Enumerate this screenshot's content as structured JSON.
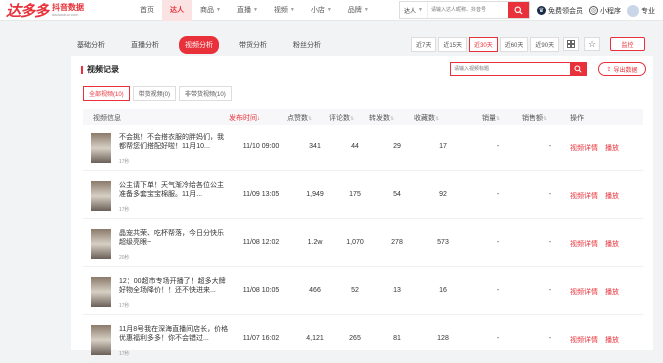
{
  "header": {
    "logo": "达多多",
    "logo_sub": "抖音数据",
    "logo_domain": "daduoduo.com",
    "nav": [
      {
        "label": "首页",
        "active": false,
        "caret": false
      },
      {
        "label": "达人",
        "active": true,
        "caret": false
      },
      {
        "label": "商品",
        "active": false,
        "caret": true
      },
      {
        "label": "直播",
        "active": false,
        "caret": true
      },
      {
        "label": "视频",
        "active": false,
        "caret": true
      },
      {
        "label": "小店",
        "active": false,
        "caret": true
      },
      {
        "label": "品牌",
        "active": false,
        "caret": true
      }
    ],
    "search_type": "达人",
    "search_placeholder": "请输入达人昵称、抖音号",
    "vip_label": "免费领会员",
    "miniapp_label": "小程序",
    "user_label": "专业"
  },
  "subnav": {
    "tabs": [
      {
        "label": "基础分析",
        "active": false
      },
      {
        "label": "直播分析",
        "active": false
      },
      {
        "label": "视频分析",
        "active": true
      },
      {
        "label": "带货分析",
        "active": false
      },
      {
        "label": "粉丝分析",
        "active": false
      }
    ],
    "ranges": [
      {
        "label": "近7天",
        "active": false
      },
      {
        "label": "近15天",
        "active": false
      },
      {
        "label": "近30天",
        "active": true
      },
      {
        "label": "近60天",
        "active": false
      },
      {
        "label": "近90天",
        "active": false
      }
    ],
    "monitor_label": "监控"
  },
  "panel": {
    "title": "视频记录",
    "search_placeholder": "请输入视频标题",
    "export_label": "导出数据",
    "filters": [
      {
        "label": "全部视频(10)",
        "active": true
      },
      {
        "label": "带货视频(0)",
        "active": false
      },
      {
        "label": "非带货视频(10)",
        "active": false
      }
    ],
    "columns": [
      "视频信息",
      "发布时间",
      "点赞数",
      "评论数",
      "转发数",
      "收藏数",
      "销量",
      "销售额",
      "操作"
    ],
    "rows": [
      {
        "title": "不会挑！不会搭衣服的胖妈们，我都帮您们搭配好啦！11月10...",
        "duration": "17秒",
        "time": "11/10 09:00",
        "likes": "341",
        "comments": "44",
        "shares": "29",
        "favs": "17",
        "sales": "-",
        "revenue": "-",
        "detail": "视频详情",
        "play": "播放"
      },
      {
        "title": "公主请下单！天气渐冷给各位公主准备多套宝宝棉服。11月...",
        "duration": "17秒",
        "time": "11/09 13:05",
        "likes": "1,949",
        "comments": "175",
        "shares": "54",
        "favs": "92",
        "sales": "-",
        "revenue": "-",
        "detail": "视频详情",
        "play": "播放"
      },
      {
        "title": "晶宠共荣、吃杯帮落，今日分快乐超级亮眼~",
        "duration": "20秒",
        "time": "11/08 12:02",
        "likes": "1.2w",
        "comments": "1,070",
        "shares": "278",
        "favs": "573",
        "sales": "-",
        "revenue": "-",
        "detail": "视频详情",
        "play": "播放"
      },
      {
        "title": "12：00超市专场开播了！超多大牌好物全场降价！！还不快进来...",
        "duration": "17秒",
        "time": "11/08 10:05",
        "likes": "466",
        "comments": "52",
        "shares": "13",
        "favs": "16",
        "sales": "-",
        "revenue": "-",
        "detail": "视频详情",
        "play": "播放"
      },
      {
        "title": "11月8号我在深海直播间店长，价格优惠福利多多！你不会错过...",
        "duration": "17秒",
        "time": "11/07 16:02",
        "likes": "4,121",
        "comments": "265",
        "shares": "81",
        "favs": "128",
        "sales": "-",
        "revenue": "-",
        "detail": "视频详情",
        "play": "播放"
      }
    ]
  }
}
